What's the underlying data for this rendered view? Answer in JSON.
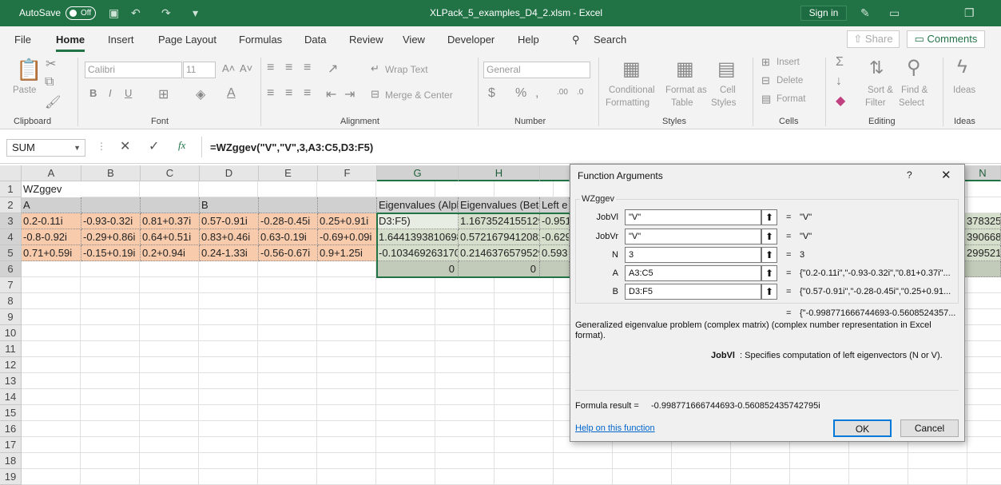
{
  "titlebar": {
    "autosave_label": "AutoSave",
    "autosave_state": "Off",
    "filename": "XLPack_5_examples_D4_2.xlsm  -  Excel",
    "signin_label": "Sign in"
  },
  "menu": {
    "tabs": [
      "File",
      "Home",
      "Insert",
      "Page Layout",
      "Formulas",
      "Data",
      "Review",
      "View",
      "Developer",
      "Help"
    ],
    "search_label": "Search",
    "share_label": "Share",
    "comments_label": "Comments"
  },
  "ribbon": {
    "paste": "Paste",
    "clipboard": "Clipboard",
    "font_name": "Calibri",
    "font_size": "11",
    "font": "Font",
    "wrap_text": "Wrap Text",
    "merge_center": "Merge & Center",
    "alignment": "Alignment",
    "number_format": "General",
    "number": "Number",
    "conditional": "Conditional",
    "formatting": "Formatting",
    "format_as": "Format as",
    "table": "Table",
    "cell": "Cell",
    "styles_btn": "Styles",
    "styles": "Styles",
    "insert": "Insert",
    "delete": "Delete",
    "format": "Format",
    "cells": "Cells",
    "sort": "Sort &",
    "filter": "Filter",
    "find": "Find &",
    "select": "Select",
    "editing": "Editing",
    "ideas_btn": "Ideas",
    "ideas": "Ideas"
  },
  "formula_bar": {
    "name_box": "SUM",
    "formula": "=WZggev(\"V\",\"V\",3,A3:C5,D3:F5)"
  },
  "sheet": {
    "columns": [
      "A",
      "B",
      "C",
      "D",
      "E",
      "F",
      "G",
      "H",
      "",
      "",
      "",
      "",
      "",
      "",
      "N"
    ],
    "rows": [
      "1",
      "2",
      "3",
      "4",
      "5",
      "6",
      "7",
      "8",
      "9",
      "10",
      "11",
      "12",
      "13",
      "14",
      "15",
      "16",
      "17",
      "18",
      "19"
    ],
    "a1": "WZggev",
    "a2": "A",
    "d2": "B",
    "g2": "Eigenvalues (Alpha)",
    "h2": "Eigenvalues (Beta)",
    "i2": "Left e",
    "matrix_a": [
      [
        "0.2-0.11i",
        "-0.93-0.32i",
        "0.81+0.37i"
      ],
      [
        "-0.8-0.92i",
        "-0.29+0.86i",
        "0.64+0.51i"
      ],
      [
        "0.71+0.59i",
        "-0.15+0.19i",
        "0.2+0.94i"
      ]
    ],
    "matrix_b": [
      [
        "0.57-0.91i",
        "-0.28-0.45i",
        "0.25+0.91i"
      ],
      [
        "0.83+0.46i",
        "0.63-0.19i",
        "-0.69+0.09i"
      ],
      [
        "0.24-1.33i",
        "-0.56-0.67i",
        "0.9+1.25i"
      ]
    ],
    "g_col": [
      "D3:F5)",
      "1.6441393810698",
      "-0.103469263170",
      "0"
    ],
    "h_col": [
      "1.16735241551299",
      "0.57216794120826",
      "0.21463765795299",
      "0"
    ],
    "i_col": [
      "-0.951",
      "-0.629",
      "0.593"
    ],
    "n_col": [
      "378325",
      "390668",
      "299521"
    ]
  },
  "dialog": {
    "title": "Function Arguments",
    "help_mark": "?",
    "close_mark": "✕",
    "func_name": "WZggev",
    "args": [
      {
        "label": "JobVl",
        "input": "\"V\"",
        "value": "\"V\""
      },
      {
        "label": "JobVr",
        "input": "\"V\"",
        "value": "\"V\""
      },
      {
        "label": "N",
        "input": "3",
        "value": "3"
      },
      {
        "label": "A",
        "input": "A3:C5",
        "value": "{\"0.2-0.11i\",\"-0.93-0.32i\",\"0.81+0.37i\"..."
      },
      {
        "label": "B",
        "input": "D3:F5",
        "value": "{\"0.57-0.91i\",\"-0.28-0.45i\",\"0.25+0.91..."
      }
    ],
    "result_preview": "{\"-0.998771666744693-0.5608524357...",
    "description": "Generalized eigenvalue problem (complex matrix) (complex number representation in Excel format).",
    "arg_help_name": "JobVl",
    "arg_help_text": ": Specifies computation of left eigenvectors (N or V).",
    "formula_result_label": "Formula result =",
    "formula_result": "-0.998771666744693-0.560852435742795i",
    "help_link": "Help on this function",
    "ok": "OK",
    "cancel": "Cancel"
  }
}
